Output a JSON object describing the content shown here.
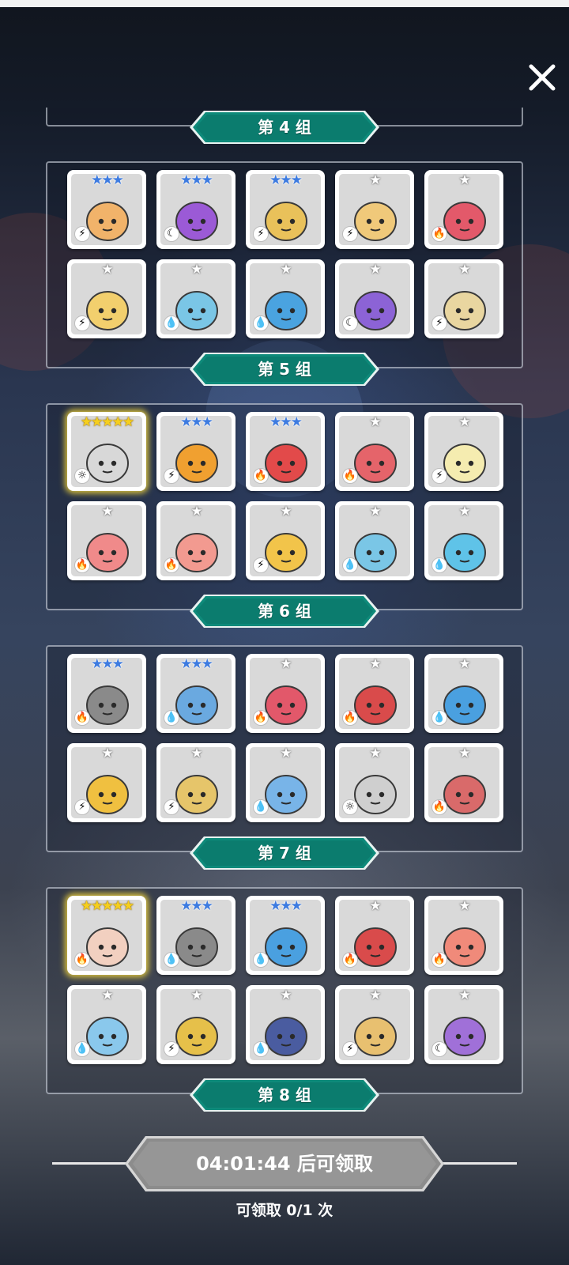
{
  "groups_top_banner": "第 4 组",
  "groups": [
    {
      "banner": "第 5 组",
      "heroes": [
        {
          "stars": "★★★",
          "star_tier": "blue",
          "element": "lightning",
          "elem_glyph": "⚡",
          "color": "#f1b36a",
          "gold": false
        },
        {
          "stars": "★★★",
          "star_tier": "blue",
          "element": "moon",
          "elem_glyph": "☾",
          "color": "#9b5ad6",
          "gold": false
        },
        {
          "stars": "★★★",
          "star_tier": "blue",
          "element": "lightning",
          "elem_glyph": "⚡",
          "color": "#e9c15a",
          "gold": false
        },
        {
          "stars": "★",
          "star_tier": "silver",
          "element": "lightning",
          "elem_glyph": "⚡",
          "color": "#f0c97a",
          "gold": false
        },
        {
          "stars": "★",
          "star_tier": "silver",
          "element": "fire",
          "elem_glyph": "🔥",
          "color": "#e3596a",
          "gold": false
        },
        {
          "stars": "★",
          "star_tier": "silver",
          "element": "lightning",
          "elem_glyph": "⚡",
          "color": "#f2cf6d",
          "gold": false
        },
        {
          "stars": "★",
          "star_tier": "silver",
          "element": "water",
          "elem_glyph": "💧",
          "color": "#7ac6e6",
          "gold": false
        },
        {
          "stars": "★",
          "star_tier": "silver",
          "element": "water",
          "elem_glyph": "💧",
          "color": "#4aa3e0",
          "gold": false
        },
        {
          "stars": "★",
          "star_tier": "silver",
          "element": "moon",
          "elem_glyph": "☾",
          "color": "#8c63d6",
          "gold": false
        },
        {
          "stars": "★",
          "star_tier": "silver",
          "element": "lightning",
          "elem_glyph": "⚡",
          "color": "#e9d6a0",
          "gold": false
        }
      ]
    },
    {
      "banner": "第 6 组",
      "heroes": [
        {
          "stars": "★★★★★",
          "star_tier": "gold",
          "element": "sun",
          "elem_glyph": "☼",
          "color": "#d8d8d8",
          "gold": true
        },
        {
          "stars": "★★★",
          "star_tier": "blue",
          "element": "lightning",
          "elem_glyph": "⚡",
          "color": "#f0a030",
          "gold": false
        },
        {
          "stars": "★★★",
          "star_tier": "blue",
          "element": "fire",
          "elem_glyph": "🔥",
          "color": "#e24a4a",
          "gold": false
        },
        {
          "stars": "★",
          "star_tier": "silver",
          "element": "fire",
          "elem_glyph": "🔥",
          "color": "#e5646a",
          "gold": false
        },
        {
          "stars": "★",
          "star_tier": "silver",
          "element": "lightning",
          "elem_glyph": "⚡",
          "color": "#f5ecb0",
          "gold": false
        },
        {
          "stars": "★",
          "star_tier": "silver",
          "element": "fire",
          "elem_glyph": "🔥",
          "color": "#f08a8a",
          "gold": false
        },
        {
          "stars": "★",
          "star_tier": "silver",
          "element": "fire",
          "elem_glyph": "🔥",
          "color": "#f29a90",
          "gold": false
        },
        {
          "stars": "★",
          "star_tier": "silver",
          "element": "lightning",
          "elem_glyph": "⚡",
          "color": "#f2c44a",
          "gold": false
        },
        {
          "stars": "★",
          "star_tier": "silver",
          "element": "water",
          "elem_glyph": "💧",
          "color": "#7ac6e6",
          "gold": false
        },
        {
          "stars": "★",
          "star_tier": "silver",
          "element": "water",
          "elem_glyph": "💧",
          "color": "#5fc3e8",
          "gold": false
        }
      ]
    },
    {
      "banner": "第 7 组",
      "heroes": [
        {
          "stars": "★★★",
          "star_tier": "blue",
          "element": "fire",
          "elem_glyph": "🔥",
          "color": "#8a8a8a",
          "gold": false
        },
        {
          "stars": "★★★",
          "star_tier": "blue",
          "element": "water",
          "elem_glyph": "💧",
          "color": "#6aa9e0",
          "gold": false
        },
        {
          "stars": "★",
          "star_tier": "silver",
          "element": "fire",
          "elem_glyph": "🔥",
          "color": "#e2586a",
          "gold": false
        },
        {
          "stars": "★",
          "star_tier": "silver",
          "element": "fire",
          "elem_glyph": "🔥",
          "color": "#d94b4b",
          "gold": false
        },
        {
          "stars": "★",
          "star_tier": "silver",
          "element": "water",
          "elem_glyph": "💧",
          "color": "#4aa0e0",
          "gold": false
        },
        {
          "stars": "★",
          "star_tier": "silver",
          "element": "lightning",
          "elem_glyph": "⚡",
          "color": "#f0c040",
          "gold": false
        },
        {
          "stars": "★",
          "star_tier": "silver",
          "element": "lightning",
          "elem_glyph": "⚡",
          "color": "#e6c56a",
          "gold": false
        },
        {
          "stars": "★",
          "star_tier": "silver",
          "element": "water",
          "elem_glyph": "💧",
          "color": "#78b4e8",
          "gold": false
        },
        {
          "stars": "★",
          "star_tier": "silver",
          "element": "sun",
          "elem_glyph": "☼",
          "color": "#cfcfcf",
          "gold": false
        },
        {
          "stars": "★",
          "star_tier": "silver",
          "element": "fire",
          "elem_glyph": "🔥",
          "color": "#d96a6a",
          "gold": false
        }
      ]
    },
    {
      "banner": "第 8 组",
      "heroes": [
        {
          "stars": "★★★★★",
          "star_tier": "gold",
          "element": "fire",
          "elem_glyph": "🔥",
          "color": "#f2d0c0",
          "gold": true
        },
        {
          "stars": "★★★",
          "star_tier": "blue",
          "element": "water",
          "elem_glyph": "💧",
          "color": "#8a8a8a",
          "gold": false
        },
        {
          "stars": "★★★",
          "star_tier": "blue",
          "element": "water",
          "elem_glyph": "💧",
          "color": "#4aa0e0",
          "gold": false
        },
        {
          "stars": "★",
          "star_tier": "silver",
          "element": "fire",
          "elem_glyph": "🔥",
          "color": "#d94b4b",
          "gold": false
        },
        {
          "stars": "★",
          "star_tier": "silver",
          "element": "fire",
          "elem_glyph": "🔥",
          "color": "#f08a7a",
          "gold": false
        },
        {
          "stars": "★",
          "star_tier": "silver",
          "element": "water",
          "elem_glyph": "💧",
          "color": "#8ac8ec",
          "gold": false
        },
        {
          "stars": "★",
          "star_tier": "silver",
          "element": "lightning",
          "elem_glyph": "⚡",
          "color": "#e6c04a",
          "gold": false
        },
        {
          "stars": "★",
          "star_tier": "silver",
          "element": "water",
          "elem_glyph": "💧",
          "color": "#4a5ca0",
          "gold": false
        },
        {
          "stars": "★",
          "star_tier": "silver",
          "element": "lightning",
          "elem_glyph": "⚡",
          "color": "#e8c070",
          "gold": false
        },
        {
          "stars": "★",
          "star_tier": "silver",
          "element": "moon",
          "elem_glyph": "☾",
          "color": "#a070d8",
          "gold": false
        }
      ]
    }
  ],
  "claim": {
    "button_label": "04:01:44 后可领取",
    "count_text": "可领取 0/1 次"
  },
  "colors": {
    "banner": "#0e8a7a",
    "banner_dark": "#075e54",
    "button": "#8c8c8c"
  }
}
